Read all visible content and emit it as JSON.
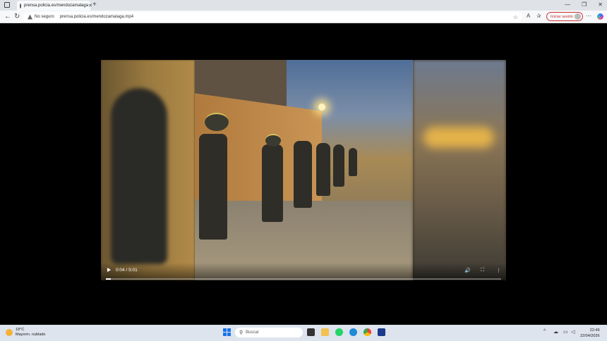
{
  "browser": {
    "tab_title": "prensa.policia.es/mendozamalaga",
    "url": "prensa.policia.es/mendozamalaga.mp4",
    "security_label": "No seguro",
    "signin_label": "Iniciar sesión"
  },
  "video": {
    "time": "0:04 / 5:01",
    "progress_fraction": 0.0133
  },
  "taskbar": {
    "weather_temp": "18°C",
    "weather_desc": "Mayorm. nublado",
    "search_placeholder": "Buscar",
    "time": "22:49",
    "date": "22/04/2026"
  },
  "colors": {
    "signin_accent": "#cc3333",
    "start_blue": "#1a73e8"
  }
}
